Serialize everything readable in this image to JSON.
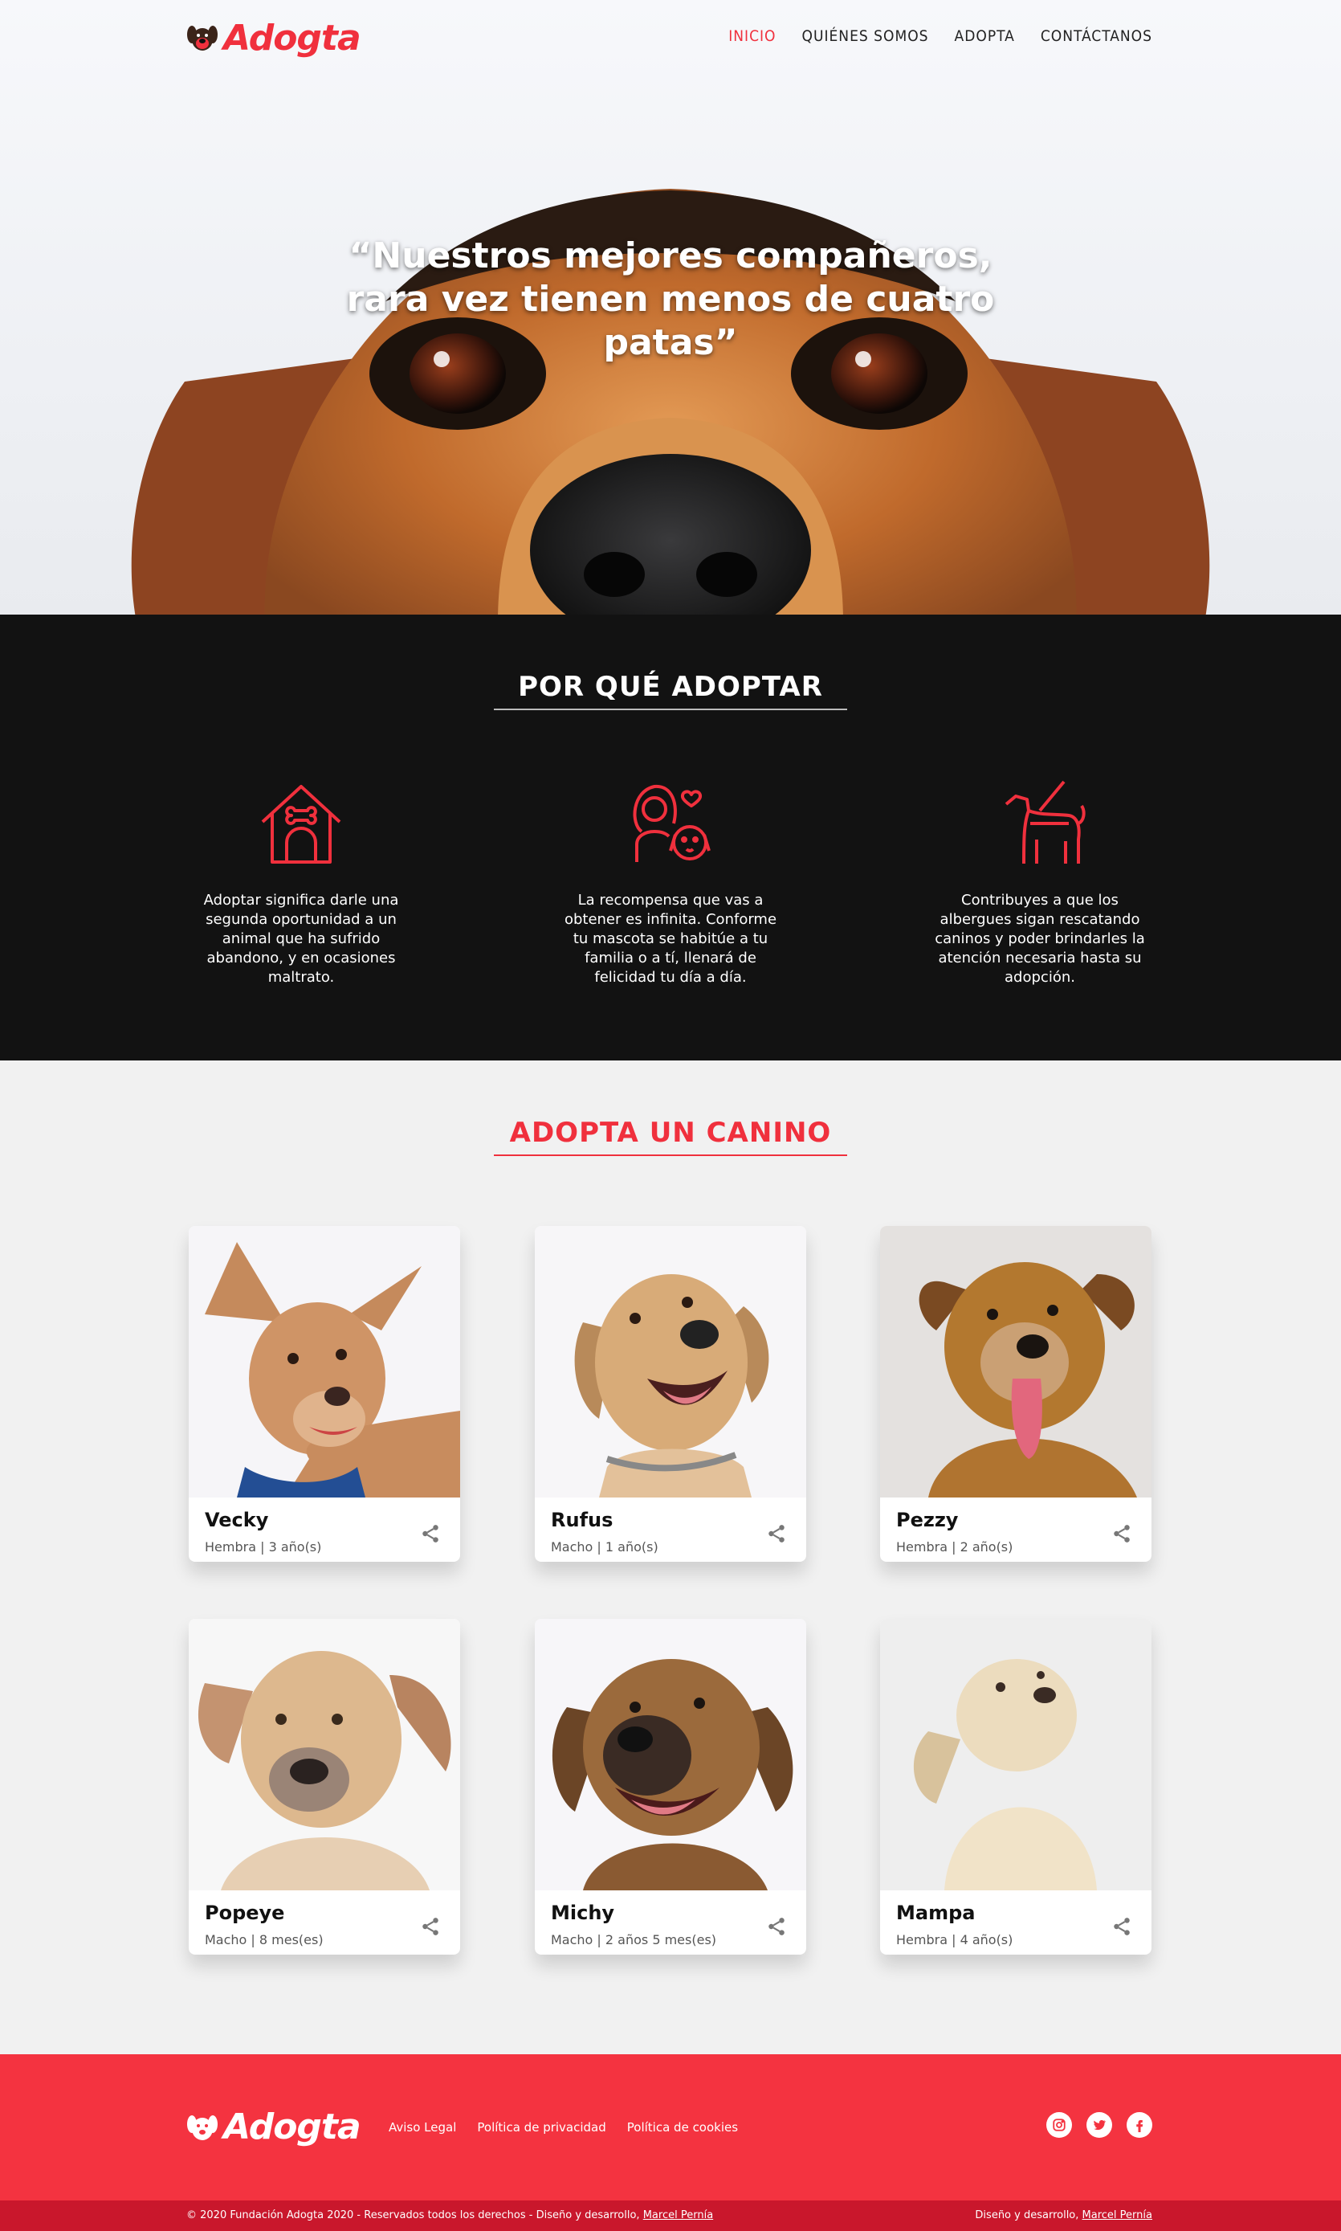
{
  "brand": {
    "name": "Adogta",
    "accent": "#f0303d",
    "footer_bg": "#f43340",
    "footer_bottom_bg": "#c9172c"
  },
  "nav": {
    "items": [
      "INICIO",
      "QUIÉNES SOMOS",
      "ADOPTA",
      "CONTÁCTANOS"
    ],
    "active": "INICIO"
  },
  "hero": {
    "quote": "“Nuestros mejores compañeros, rara vez tienen menos de cuatro patas”"
  },
  "why": {
    "title": "POR QUÉ ADOPTAR",
    "items": [
      {
        "icon": "dog-house-icon",
        "text": "Adoptar significa darle una segunda oportunidad a un animal que ha sufrido abandono, y en ocasiones maltrato."
      },
      {
        "icon": "woman-dog-love-icon",
        "text": "La recompensa que vas a obtener es infinita. Conforme tu mascota se habitúe a tu familia o a tí, llenará de felicidad tu día a día."
      },
      {
        "icon": "guide-dog-icon",
        "text": "Contribuyes a que los albergues sigan rescatando caninos y poder brindarles la atención necesaria hasta su adopción."
      }
    ]
  },
  "adopt": {
    "title": "ADOPTA UN CANINO",
    "dogs": [
      {
        "name": "Vecky",
        "meta": "Hembra | 3 año(s)"
      },
      {
        "name": "Rufus",
        "meta": "Macho | 1 año(s)"
      },
      {
        "name": "Pezzy",
        "meta": "Hembra | 2 año(s)"
      },
      {
        "name": "Popeye",
        "meta": "Macho | 8 mes(es)"
      },
      {
        "name": "Michy",
        "meta": "Macho | 2 años 5 mes(es)"
      },
      {
        "name": "Mampa",
        "meta": "Hembra | 4 año(s)"
      }
    ]
  },
  "footer": {
    "links": [
      "Aviso Legal",
      "Política de privacidad",
      "Política de cookies"
    ],
    "socials": [
      "instagram-icon",
      "twitter-icon",
      "facebook-icon"
    ],
    "copyright_prefix": "© 2020 Fundación Adogta 2020 - Reservados todos los derechos - Diseño y desarrollo,",
    "credit_prefix": "Diseño y desarrollo,",
    "designer": "Marcel Pernía"
  }
}
